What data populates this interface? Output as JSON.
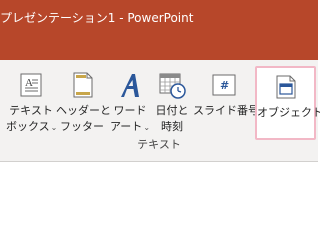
{
  "window": {
    "title": "プレゼンテーション1  -  PowerPoint"
  },
  "ribbon": {
    "group_label": "テキスト",
    "buttons": [
      {
        "line1": "テキスト",
        "line2": "ボックス",
        "has_dropdown": true,
        "icon": "text-box-icon"
      },
      {
        "line1": "ヘッダーと",
        "line2": "フッター",
        "has_dropdown": false,
        "icon": "header-footer-icon"
      },
      {
        "line1": "ワード",
        "line2": "アート",
        "has_dropdown": true,
        "icon": "wordart-icon"
      },
      {
        "line1": "日付と",
        "line2": "時刻",
        "has_dropdown": false,
        "icon": "date-time-icon"
      },
      {
        "line1": "スライド番号",
        "line2": "",
        "has_dropdown": false,
        "icon": "slide-number-icon"
      },
      {
        "line1": "オブジェクト",
        "line2": "",
        "has_dropdown": false,
        "icon": "object-icon",
        "selected": true
      }
    ]
  },
  "colors": {
    "title_bar": "#b7472a",
    "ribbon_bg": "#f3f2f1",
    "accent_blue": "#2b579a",
    "selection_border": "#f2b8c6"
  }
}
